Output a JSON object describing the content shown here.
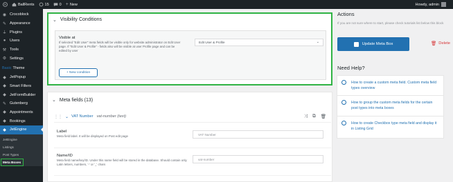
{
  "admin_bar": {
    "site_name": "BallRents",
    "updates_count": "15",
    "comments_count": "0",
    "new_label": "New",
    "howdy": "Howdy, admin"
  },
  "sidebar": {
    "items": [
      {
        "label": "Crocoblock",
        "icon": "crocoblock-icon"
      },
      {
        "label": "Appearance",
        "icon": "brush-icon"
      },
      {
        "label": "Plugins",
        "icon": "plug-icon"
      },
      {
        "label": "Users",
        "icon": "user-icon"
      },
      {
        "label": "Tools",
        "icon": "wrench-icon"
      },
      {
        "label": "Settings",
        "icon": "settings-icon"
      }
    ],
    "theme_label": "Theme",
    "theme_prefix": "Basic",
    "plugins": [
      {
        "label": "JetPopup",
        "icon": "jet-icon"
      },
      {
        "label": "Smart Filters",
        "icon": "jet-icon"
      },
      {
        "label": "JetFormBuilder",
        "icon": "jet-icon"
      },
      {
        "label": "Gutenberg",
        "icon": "gutenberg-icon"
      },
      {
        "label": "Appointments",
        "icon": "jet-icon"
      },
      {
        "label": "Bookings",
        "icon": "jet-icon"
      },
      {
        "label": "JetEngine",
        "icon": "jet-icon"
      }
    ],
    "submenu": [
      "JetEngine",
      "Listings",
      "Post Types",
      "Meta Boxes"
    ]
  },
  "visibility": {
    "title": "Visibility Conditions",
    "visible_at_label": "Visible at",
    "visible_at_desc": "If selected \"Edit User\" meta fields will be visible only for website administrator on Edit User page. If \"Edit User & Profile\" - fields also will be visible at user Profile page and can be edited by user",
    "select_value": "Edit User & Profile",
    "new_condition_label": "+ New condition"
  },
  "meta_fields": {
    "title": "Meta fields (13)",
    "field_name": "VAT Number",
    "field_meta": "vat-number (text)",
    "label_title": "Label",
    "label_desc": "Meta field label. It will be displayed on Post edit page",
    "label_value": "VAT Number",
    "name_title": "Name/ID",
    "name_desc": "Meta field name/key/ID. Under this name field will be stored in the database. Should contain only Latin letters, numbers, '-' or '_' chars",
    "name_value": "vat-number"
  },
  "actions": {
    "title": "Actions",
    "hint": "If you are not sure where to start, please check tutorials list below this block",
    "update_label": "Update Meta Box",
    "delete_label": "Delete"
  },
  "help": {
    "title": "Need Help?",
    "links": [
      "How to create a custom meta field. Custom meta field types overview",
      "How to group the custom meta fields for the certain post types into meta boxes",
      "How to create Checkbox type meta field and display it in Listing Grid"
    ]
  },
  "colors": {
    "accent": "#2271b1",
    "highlight": "#2fb344",
    "danger": "#d63638",
    "admin_dark": "#1d2327"
  }
}
